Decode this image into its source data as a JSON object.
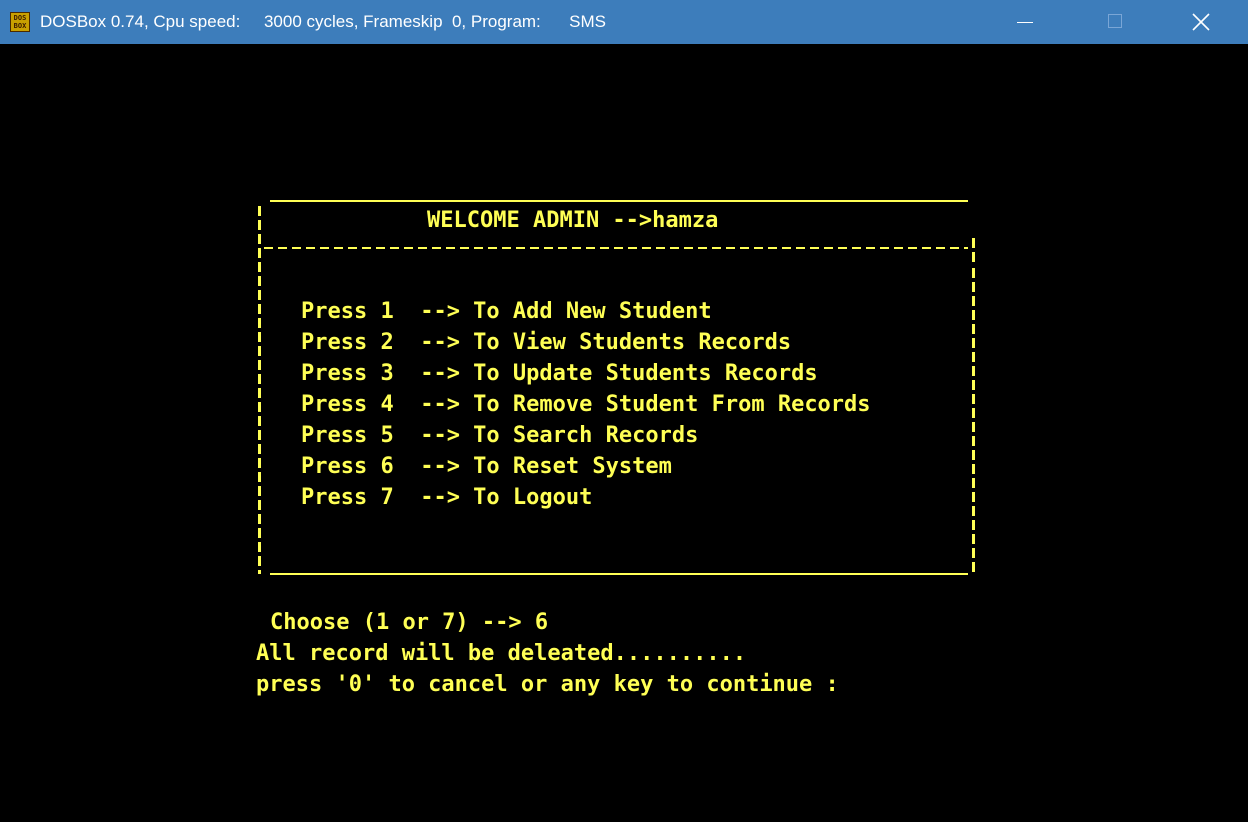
{
  "window": {
    "app_icon_text": "DOS BOX",
    "title": "DOSBox 0.74, Cpu speed:     3000 cycles, Frameskip  0, Program:      SMS",
    "minimize_icon": "minimize-icon",
    "maximize_icon": "maximize-icon",
    "close_icon": "close-icon"
  },
  "menu": {
    "heading": "WELCOME ADMIN -->hamza",
    "options": [
      "Press 1  --> To Add New Student",
      "Press 2  --> To View Students Records",
      "Press 3  --> To Update Students Records",
      "Press 4  --> To Remove Student From Records",
      "Press 5  --> To Search Records",
      "Press 6  --> To Reset System",
      "Press 7  --> To Logout"
    ]
  },
  "console": {
    "choice_line": "Choose (1 or 7) --> 6",
    "warning_line": "All record will be deleated..........",
    "prompt_line": "press '0' to cancel or any key to continue :"
  },
  "colors": {
    "titlebar": "#3d7dbb",
    "terminal_bg": "#000000",
    "terminal_text": "#ffff55"
  }
}
